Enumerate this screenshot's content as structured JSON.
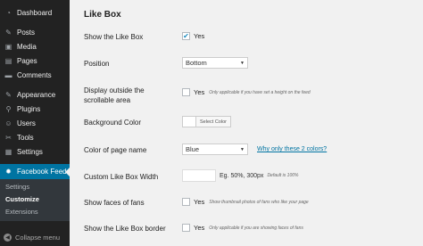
{
  "sidebar": {
    "items": [
      {
        "label": "Dashboard",
        "icon": "dashboard-icon",
        "glyph": "◔"
      },
      {
        "label": "Posts",
        "icon": "pin-icon",
        "glyph": "✎"
      },
      {
        "label": "Media",
        "icon": "media-icon",
        "glyph": "▣"
      },
      {
        "label": "Pages",
        "icon": "pages-icon",
        "glyph": "▤"
      },
      {
        "label": "Comments",
        "icon": "comments-icon",
        "glyph": "▬"
      },
      {
        "label": "Appearance",
        "icon": "appearance-icon",
        "glyph": "✎"
      },
      {
        "label": "Plugins",
        "icon": "plugins-icon",
        "glyph": "⚲"
      },
      {
        "label": "Users",
        "icon": "users-icon",
        "glyph": "☺"
      },
      {
        "label": "Tools",
        "icon": "tools-icon",
        "glyph": "✂"
      },
      {
        "label": "Settings",
        "icon": "settings-icon",
        "glyph": "▦"
      }
    ],
    "active": {
      "label": "Facebook Feed",
      "icon": "gear-icon",
      "glyph": "✹"
    },
    "submenu": [
      "Settings",
      "Customize",
      "Extensions"
    ],
    "submenu_current": "Customize",
    "collapse_label": "Collapse menu"
  },
  "main": {
    "heading": "Like Box",
    "show_like_box": {
      "label": "Show the Like Box",
      "checked": true,
      "value": "Yes"
    },
    "position": {
      "label": "Position",
      "value": "Bottom"
    },
    "display_outside": {
      "label_line1": "Display outside the",
      "label_line2": "scrollable area",
      "checked": false,
      "value": "Yes",
      "note": "Only applicable if you have set a height on the feed"
    },
    "background_color": {
      "label": "Background Color",
      "button": "Select Color"
    },
    "color_page_name": {
      "label": "Color of page name",
      "value": "Blue",
      "link": "Why only these 2 colors?"
    },
    "custom_width": {
      "label": "Custom Like Box Width",
      "value": "",
      "hint": "Eg. 50%, 300px",
      "default": "Default is 100%"
    },
    "show_faces": {
      "label": "Show faces of fans",
      "checked": false,
      "value": "Yes",
      "note": "Show thumbnail photos of fans who like your page"
    },
    "like_box_border": {
      "label": "Show the Like Box border",
      "checked": false,
      "value": "Yes",
      "note": "Only applicable if you are showing faces of fans"
    }
  },
  "colors": {
    "sidebar_bg": "#222222",
    "active_bg": "#0074a2",
    "page_bg": "#f1f1f1",
    "link": "#0074a2"
  }
}
